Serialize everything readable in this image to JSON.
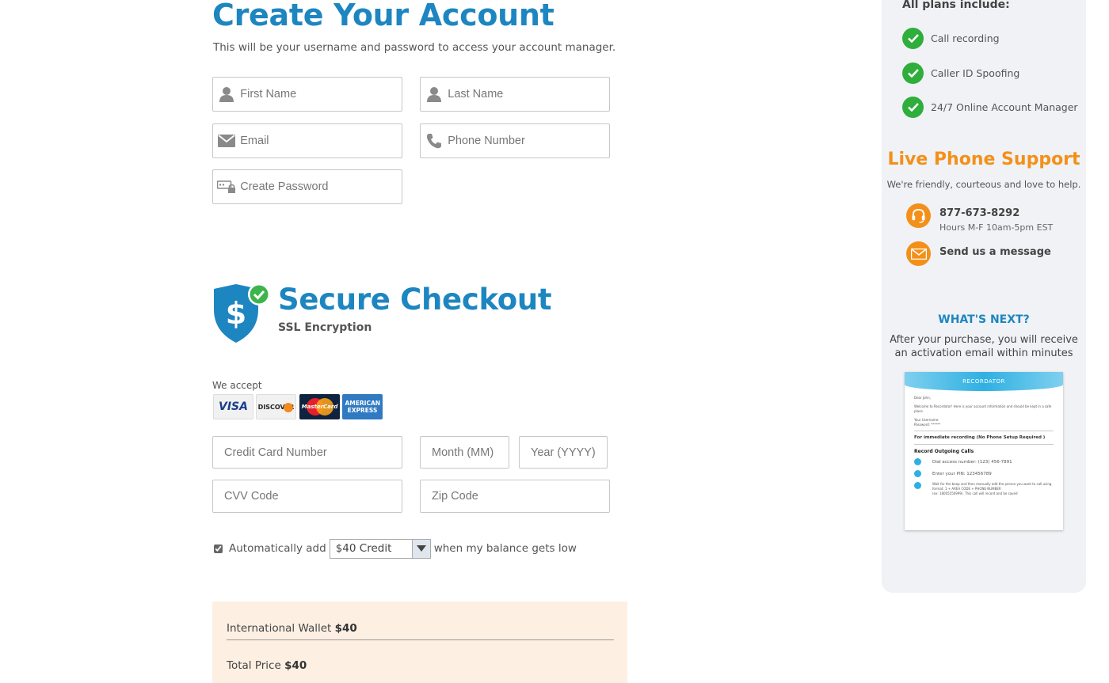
{
  "account": {
    "title": "Create Your Account",
    "subtitle": "This will be your username and password to access your account manager.",
    "first_name_placeholder": "First Name",
    "last_name_placeholder": "Last Name",
    "email_placeholder": "Email",
    "phone_placeholder": "Phone Number",
    "password_placeholder": "Create Password"
  },
  "checkout": {
    "title": "Secure Checkout",
    "subtitle": "SSL Encryption",
    "we_accept": "We accept",
    "cards": [
      {
        "name": "VISA",
        "icon": "visa-icon"
      },
      {
        "name": "DISCOVER",
        "icon": "discover-icon"
      },
      {
        "name": "MasterCard",
        "icon": "mastercard-icon"
      },
      {
        "name": "AMERICAN EXPRESS",
        "icon": "amex-icon"
      }
    ],
    "cc_placeholder": "Credit Card Number",
    "month_placeholder": "Month (MM)",
    "year_placeholder": "Year (YYYY)",
    "cvv_placeholder": "CVV Code",
    "zip_placeholder": "Zip Code",
    "auto_add_label": "Automatically add",
    "auto_add_checked": true,
    "credit_option": "$40 Credit",
    "auto_add_suffix": "when my balance gets low"
  },
  "summary": {
    "wallet_label": "International Wallet",
    "wallet_value": "$40",
    "total_label": "Total Price",
    "total_value": "$40"
  },
  "sidebar": {
    "plans_heading": "All plans include:",
    "features": [
      "Call recording",
      "Caller ID Spoofing",
      "24/7 Online Account Manager"
    ],
    "support_title": "Live Phone Support",
    "support_sub": "We're friendly, courteous and love to help.",
    "phone": "877-673-8292",
    "hours": "Hours M-F 10am-5pm EST",
    "message": "Send us a message",
    "next_title": "WHAT'S NEXT?",
    "next_text": "After your purchase, you will receive an activation email within minutes"
  },
  "email_preview": {
    "brand": "RECORDATOR",
    "greeting": "Dear John,",
    "intro": "Welcome to Recordator! Here is your account information and should be kept in a safe place.",
    "user_label": "Your Username:",
    "pass_label": "Password: ******",
    "immediate": "For immediate recording (No Phone Setup Required )",
    "outgoing": "Record Outgoing Calls",
    "step1": "Dial access number: (123) 456-7891",
    "step2": "Enter your PIN: 123456789",
    "step3": "Wait for the beep and then manually add the person you want to call using format: 1 + AREA CODE + PHONE NUMBER",
    "step3b": "(ex: 18005550999). This call will record and be saved"
  },
  "colors": {
    "brand_blue": "#1d86c0",
    "accent_orange": "#f39019",
    "check_green": "#2fae3c",
    "summary_bg": "#fdf0e3"
  }
}
